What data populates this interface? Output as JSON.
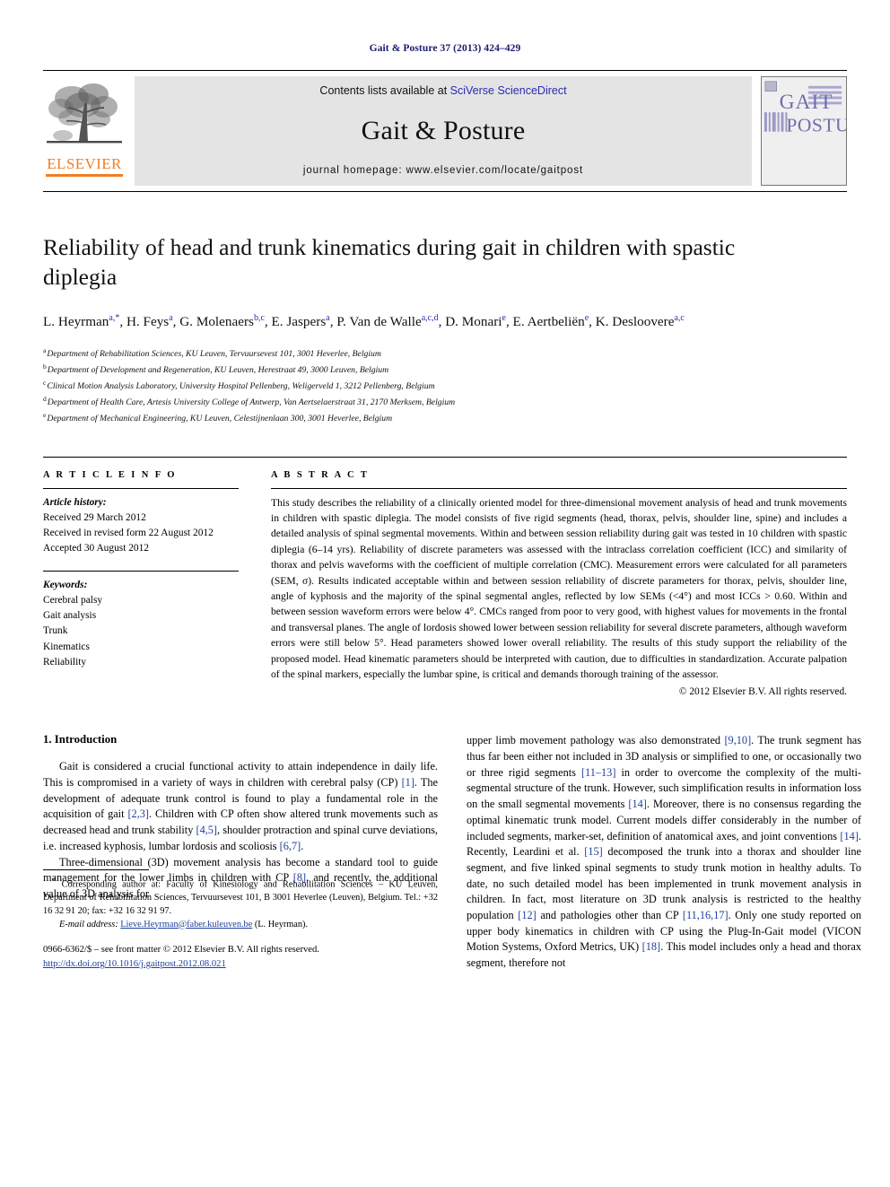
{
  "running_head": "Gait & Posture 37 (2013) 424–429",
  "masthead": {
    "contents_prefix": "Contents lists available at ",
    "contents_link": "SciVerse ScienceDirect",
    "journal_name": "Gait & Posture",
    "homepage": "journal homepage: www.elsevier.com/locate/gaitpost",
    "publisher_word": "ELSEVIER",
    "cover_line1": "GAIT",
    "cover_line2": "POSTURE"
  },
  "article": {
    "title": "Reliability of head and trunk kinematics during gait in children with spastic diplegia",
    "authors": [
      {
        "name": "L. Heyrman",
        "marks": "a,*"
      },
      {
        "name": "H. Feys",
        "marks": "a"
      },
      {
        "name": "G. Molenaers",
        "marks": "b,c"
      },
      {
        "name": "E. Jaspers",
        "marks": "a"
      },
      {
        "name": "P. Van de Walle",
        "marks": "a,c,d"
      },
      {
        "name": "D. Monari",
        "marks": "e"
      },
      {
        "name": "E. Aertbeliën",
        "marks": "e"
      },
      {
        "name": "K. Desloovere",
        "marks": "a,c"
      }
    ],
    "affiliations": [
      {
        "mark": "a",
        "text": "Department of Rehabilitation Sciences, KU Leuven, Tervuursevest 101, 3001 Heverlee, Belgium"
      },
      {
        "mark": "b",
        "text": "Department of Development and Regeneration, KU Leuven, Herestraat 49, 3000 Leuven, Belgium"
      },
      {
        "mark": "c",
        "text": "Clinical Motion Analysis Laboratory, University Hospital Pellenberg, Weligerveld 1, 3212 Pellenberg, Belgium"
      },
      {
        "mark": "d",
        "text": "Department of Health Care, Artesis University College of Antwerp, Van Aertselaerstraat 31, 2170 Merksem, Belgium"
      },
      {
        "mark": "e",
        "text": "Department of Mechanical Engineering, KU Leuven, Celestijnenlaan 300, 3001 Heverlee, Belgium"
      }
    ]
  },
  "article_info": {
    "heading": "A R T I C L E   I N F O",
    "history_label": "Article history:",
    "history": [
      "Received 29 March 2012",
      "Received in revised form 22 August 2012",
      "Accepted 30 August 2012"
    ],
    "keywords_label": "Keywords:",
    "keywords": [
      "Cerebral palsy",
      "Gait analysis",
      "Trunk",
      "Kinematics",
      "Reliability"
    ]
  },
  "abstract": {
    "heading": "A B S T R A C T",
    "text": "This study describes the reliability of a clinically oriented model for three-dimensional movement analysis of head and trunk movements in children with spastic diplegia. The model consists of five rigid segments (head, thorax, pelvis, shoulder line, spine) and includes a detailed analysis of spinal segmental movements. Within and between session reliability during gait was tested in 10 children with spastic diplegia (6–14 yrs). Reliability of discrete parameters was assessed with the intraclass correlation coefficient (ICC) and similarity of thorax and pelvis waveforms with the coefficient of multiple correlation (CMC). Measurement errors were calculated for all parameters (SEM, σ). Results indicated acceptable within and between session reliability of discrete parameters for thorax, pelvis, shoulder line, angle of kyphosis and the majority of the spinal segmental angles, reflected by low SEMs (<4°) and most ICCs > 0.60. Within and between session waveform errors were below 4°. CMCs ranged from poor to very good, with highest values for movements in the frontal and transversal planes. The angle of lordosis showed lower between session reliability for several discrete parameters, although waveform errors were still below 5°. Head parameters showed lower overall reliability. The results of this study support the reliability of the proposed model. Head kinematic parameters should be interpreted with caution, due to difficulties in standardization. Accurate palpation of the spinal markers, especially the lumbar spine, is critical and demands thorough training of the assessor.",
    "copyright": "© 2012 Elsevier B.V. All rights reserved."
  },
  "body": {
    "section_title": "1. Introduction",
    "left_paragraph_1": "Gait is considered a crucial functional activity to attain independence in daily life. This is compromised in a variety of ways in children with cerebral palsy (CP) [1]. The development of adequate trunk control is found to play a fundamental role in the acquisition of gait [2,3]. Children with CP often show altered trunk movements such as decreased head and trunk stability [4,5], shoulder protraction and spinal curve deviations, i.e. increased kyphosis, lumbar lordosis and scoliosis [6,7].",
    "left_paragraph_2": "Three-dimensional (3D) movement analysis has become a standard tool to guide management for the lower limbs in children with CP [8], and recently, the additional value of 3D analysis for",
    "right_paragraph_1": "upper limb movement pathology was also demonstrated [9,10]. The trunk segment has thus far been either not included in 3D analysis or simplified to one, or occasionally two or three rigid segments [11–13] in order to overcome the complexity of the multi-segmental structure of the trunk. However, such simplification results in information loss on the small segmental movements [14]. Moreover, there is no consensus regarding the optimal kinematic trunk model. Current models differ considerably in the number of included segments, marker-set, definition of anatomical axes, and joint conventions [14]. Recently, Leardini et al. [15] decomposed the trunk into a thorax and shoulder line segment, and five linked spinal segments to study trunk motion in healthy adults. To date, no such detailed model has been implemented in trunk movement analysis in children. In fact, most literature on 3D trunk analysis is restricted to the healthy population [12] and pathologies other than CP [11,16,17]. Only one study reported on upper body kinematics in children with CP using the Plug-In-Gait model (VICON Motion Systems, Oxford Metrics, UK) [18]. This model includes only a head and thorax segment, therefore not"
  },
  "footnote": {
    "corresponding": "Corresponding author at: Faculty of Kinesiology and Rehabilitation Sciences – KU Leuven, Department of Rehabilitation Sciences, Tervuursevest 101, B 3001 Heverlee (Leuven), Belgium. Tel.: +32 16 32 91 20; fax: +32 16 32 91 97.",
    "email_label": "E-mail address:",
    "email": "Lieve.Heyrman@faber.kuleuven.be",
    "email_owner": "(L. Heyrman).",
    "issn_line": "0966-6362/$ – see front matter © 2012 Elsevier B.V. All rights reserved.",
    "doi": "http://dx.doi.org/10.1016/j.gaitpost.2012.08.021"
  },
  "colors": {
    "link_blue": "#2a2ab4",
    "ref_blue": "#1f3f9e",
    "elsevier_orange": "#f47c20",
    "header_navy": "#1a1a6e",
    "cover_purple": "#6f6fae"
  }
}
